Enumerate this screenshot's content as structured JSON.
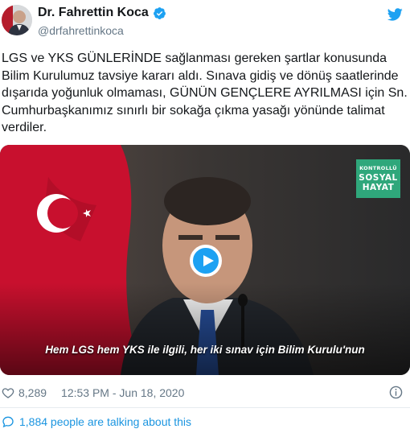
{
  "author": {
    "name": "Dr. Fahrettin Koca",
    "handle": "@drfahrettinkoca"
  },
  "tweet": {
    "text": "LGS ve YKS GÜNLERİNDE sağlanması gereken şartlar konusunda\nBilim Kurulumuz tavsiye kararı aldı. Sınava gidiş ve dönüş saatlerinde\ndışarıda yoğunluk olmaması, GÜNÜN GENÇLERE AYRILMASI için Sn.\nCumhurbaşkanımız sınırlı bir sokağa çıkma yasağı yönünde talimat\nverdiler."
  },
  "video": {
    "badge_line1": "KONTROLLÜ",
    "badge_line2": "SOSYAL",
    "badge_line3": "HAYAT",
    "subtitle": "Hem LGS hem YKS ile ilgili, her iki sınav için Bilim Kurulu'nun"
  },
  "meta": {
    "likes": "8,289",
    "timestamp": "12:53 PM - Jun 18, 2020"
  },
  "footer": {
    "talking": "1,884 people are talking about this"
  },
  "colors": {
    "twitter_blue": "#1da1f2",
    "link_blue": "#1b95e0",
    "muted_gray": "#657786",
    "badge_green": "#2fa77b",
    "flag_red": "#c8102e"
  },
  "icons": [
    "verified-badge-icon",
    "twitter-bird-icon",
    "play-icon",
    "heart-icon",
    "info-icon",
    "speech-bubble-icon"
  ]
}
